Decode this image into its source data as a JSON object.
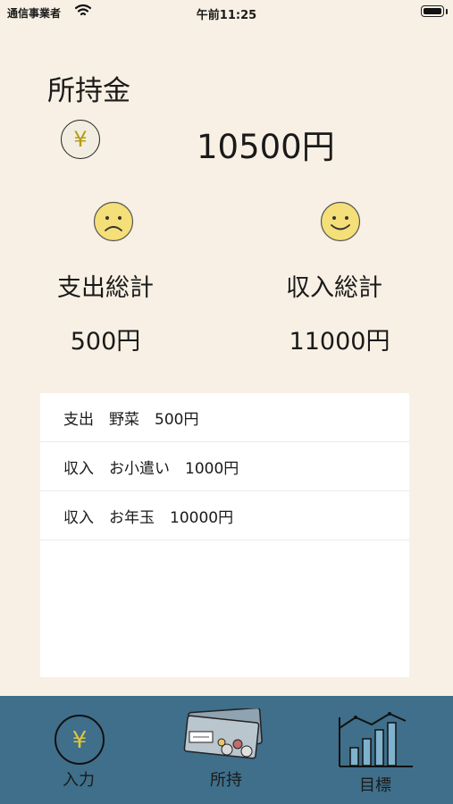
{
  "status_bar": {
    "carrier": "通信事業者",
    "time": "午前11:25"
  },
  "balance": {
    "title": "所持金",
    "currency_symbol": "¥",
    "amount": "10500円"
  },
  "summary": {
    "expense_label": "支出総計",
    "expense_value": "500円",
    "income_label": "収入総計",
    "income_value": "11000円"
  },
  "transactions": [
    {
      "text": "支出　野菜　500円"
    },
    {
      "text": "収入　お小遣い　1000円"
    },
    {
      "text": "収入　お年玉　10000円"
    }
  ],
  "tabs": [
    {
      "label": "入力",
      "icon": "yen-coin-icon"
    },
    {
      "label": "所持",
      "icon": "wallet-icon"
    },
    {
      "label": "目標",
      "icon": "bar-chart-icon"
    }
  ],
  "colors": {
    "background": "#f8f0e4",
    "tab_bar": "#3f6f8a",
    "face_yellow": "#f4df78",
    "yen_gold": "#b79b12"
  }
}
